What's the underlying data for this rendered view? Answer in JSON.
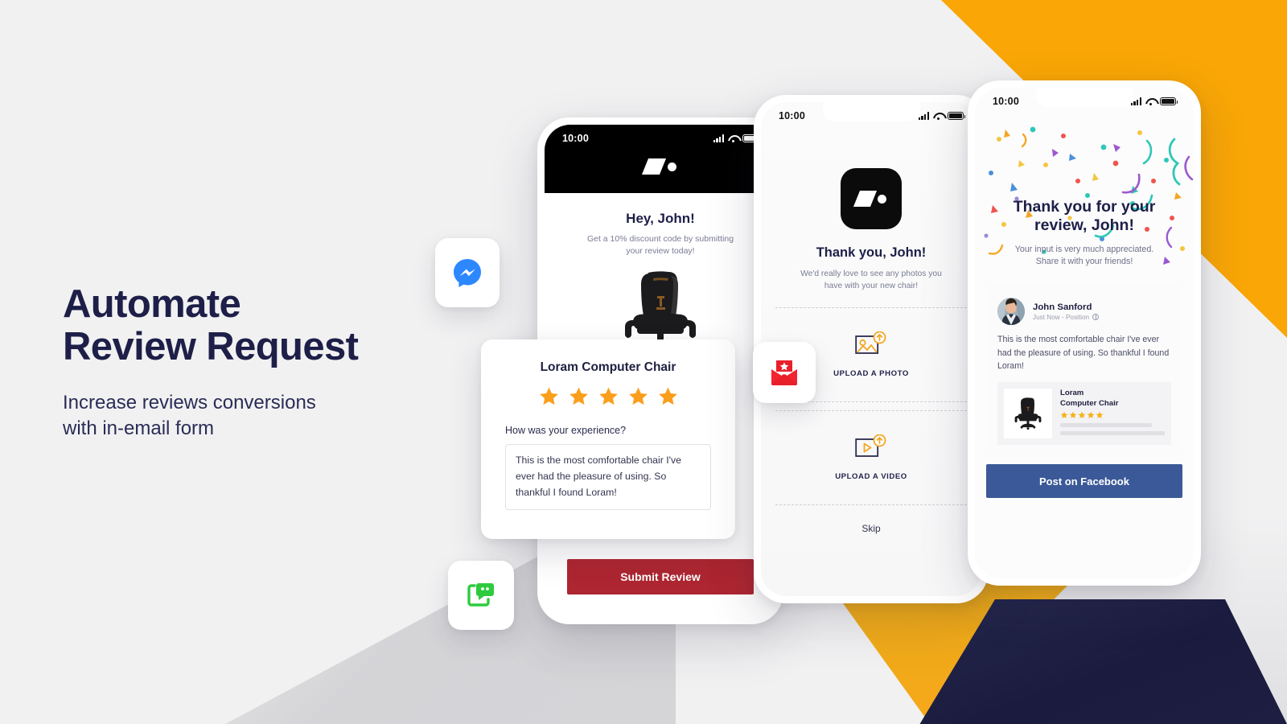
{
  "hero": {
    "headline_line1": "Automate",
    "headline_line2": "Review Request",
    "subheadline_line1": "Increase reviews conversions",
    "subheadline_line2": "with in-email form"
  },
  "colors": {
    "navy": "#1E1F48",
    "orange_bg": "#F9A606",
    "gold": "#EEAB18",
    "star": "#FA9E1B",
    "submit_red": "#AD2631",
    "facebook_blue": "#3B5998",
    "messenger_blue": "#2D88FF",
    "sms_green": "#2ECB3F",
    "mail_red": "#E8202A",
    "page_bg": "#F1F1F2"
  },
  "phone1": {
    "status": {
      "time": "10:00",
      "signal": "signal-icon",
      "wifi": "wifi-icon",
      "battery": "battery-icon"
    },
    "logo": "loram-logo",
    "title": "Hey, John!",
    "subtitle_line1": "Get a 10% discount code by submitting",
    "subtitle_line2": "your review today!",
    "product_image": "computer-chair-image",
    "submit_label": "Submit Review"
  },
  "review_card": {
    "product_title": "Loram Computer Chair",
    "rating": 5,
    "rating_max": 5,
    "question_label": "How was your experience?",
    "review_text": "This is the most comfortable chair I've ever had the pleasure of using. So thankful I found Loram!"
  },
  "phone2": {
    "status": {
      "time": "10:00",
      "signal": "signal-icon",
      "wifi": "wifi-icon",
      "battery": "battery-icon"
    },
    "logo": "loram-logo-square",
    "title": "Thank you, John!",
    "subtitle_line1": "We'd really love to see any photos you",
    "subtitle_line2": "have with your new chair!",
    "upload_photo_label": "UPLOAD A PHOTO",
    "upload_video_label": "UPLOAD A VIDEO",
    "skip_label": "Skip"
  },
  "phone3": {
    "status": {
      "time": "10:00",
      "signal": "signal-icon",
      "wifi": "wifi-icon",
      "battery": "battery-icon"
    },
    "title_line1": "Thank you for your",
    "title_line2": "review, John!",
    "subtitle_line1": "Your input is very much appreciated.",
    "subtitle_line2": "Share it with your friends!",
    "post": {
      "author": "John Sanford",
      "meta": "Just Now - Position",
      "body": "This is the most comfortable chair I've ever had the pleasure of using. So thankful I found Loram!",
      "product_name_line1": "Loram",
      "product_name_line2": "Computer Chair",
      "product_rating": 5
    },
    "share_button_label": "Post on Facebook"
  },
  "badges": [
    {
      "name": "messenger-icon",
      "label": "Facebook Messenger"
    },
    {
      "name": "review-mail-icon",
      "label": "Review email"
    },
    {
      "name": "sms-icon",
      "label": "SMS message"
    }
  ]
}
